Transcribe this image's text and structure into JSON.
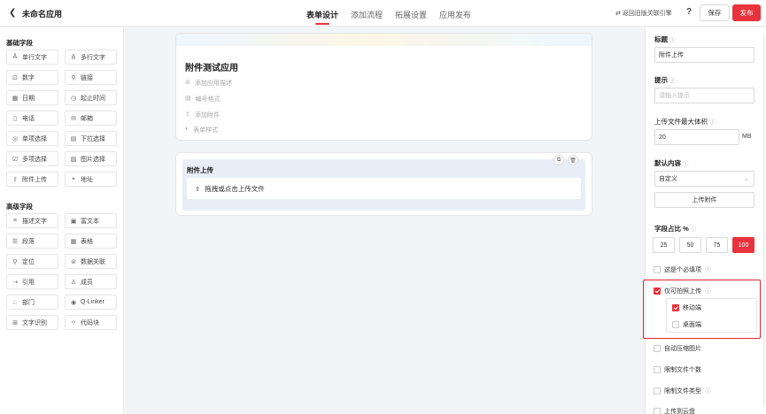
{
  "header": {
    "back_icon": "chevron-left-icon",
    "app_title": "未命名应用",
    "tabs": [
      {
        "label": "表单设计",
        "active": true
      },
      {
        "label": "添加流程",
        "active": false
      },
      {
        "label": "拓展设置",
        "active": false
      },
      {
        "label": "应用发布",
        "active": false
      }
    ],
    "return_link": "⇄ 返回旧版关联引擎",
    "help": "?",
    "save_label": "保存",
    "publish_label": "发布",
    "accent_color": "#e8333d"
  },
  "left_panel": {
    "basic_title": "基础字段",
    "basic_fields": [
      {
        "icon": "Ā",
        "label": "单行文字"
      },
      {
        "icon": "A̲",
        "label": "多行文字"
      },
      {
        "icon": "⊡",
        "label": "数字"
      },
      {
        "icon": "⚲",
        "label": "链接"
      },
      {
        "icon": "▦",
        "label": "日期"
      },
      {
        "icon": "◷",
        "label": "起止时间"
      },
      {
        "icon": "▯",
        "label": "电话"
      },
      {
        "icon": "✉",
        "label": "邮箱"
      },
      {
        "icon": "◎",
        "label": "单项选择"
      },
      {
        "icon": "▤",
        "label": "下拉选择"
      },
      {
        "icon": "☑",
        "label": "多项选择"
      },
      {
        "icon": "▨",
        "label": "图片选择"
      },
      {
        "icon": "⇧",
        "label": "附件上传"
      },
      {
        "icon": "⌖",
        "label": "地址"
      }
    ],
    "advanced_title": "高级字段",
    "advanced_fields": [
      {
        "icon": "≡",
        "label": "描述文字"
      },
      {
        "icon": "▣",
        "label": "富文本"
      },
      {
        "icon": "☰",
        "label": "段落"
      },
      {
        "icon": "▦",
        "label": "表格"
      },
      {
        "icon": "⚲",
        "label": "定位"
      },
      {
        "icon": "⊜",
        "label": "数据关联"
      },
      {
        "icon": "⇢",
        "label": "引用"
      },
      {
        "icon": "♙",
        "label": "成员"
      },
      {
        "icon": "♘",
        "label": "部门"
      },
      {
        "icon": "◉",
        "label": "Q-Linker"
      },
      {
        "icon": "⊞",
        "label": "文字识别"
      },
      {
        "icon": "‹›",
        "label": "代码块"
      }
    ]
  },
  "canvas": {
    "form_title": "附件测试应用",
    "meta_items": [
      {
        "icon": "⊜",
        "label": "添加应用描述"
      },
      {
        "icon": "▤",
        "label": "编号格式"
      },
      {
        "icon": "⇧",
        "label": "添加附件"
      },
      {
        "icon": "◐",
        "label": "表单样式"
      }
    ],
    "selected_field": {
      "label": "附件上传",
      "upload_hint": "拖拽或点击上传文件",
      "copy_icon": "⧉",
      "delete_icon": "🗑"
    }
  },
  "right_panel": {
    "title_label": "标题",
    "title_value": "附件上传",
    "hint_label": "提示",
    "hint_placeholder": "请输入提示",
    "max_size_label": "上传文件最大体积",
    "max_size_value": "20",
    "max_size_unit": "MB",
    "default_label": "默认内容",
    "default_select": "自定义",
    "upload_attachment_btn": "上传附件",
    "width_label": "字段占比 %",
    "width_options": [
      "25",
      "50",
      "75",
      "100"
    ],
    "width_selected": "100",
    "required_label": "这是个必填项",
    "required_checked": false,
    "camera_only_label": "仅可拍照上传",
    "camera_only_checked": true,
    "mobile_label": "移动端",
    "mobile_checked": true,
    "desktop_label": "桌面端",
    "desktop_checked": false,
    "compress_label": "自动压缩图片",
    "limit_count_label": "限制文件个数",
    "limit_type_label": "限制文件类型",
    "upload_cloud_label": "上传到云盘",
    "question_icon": "?"
  }
}
